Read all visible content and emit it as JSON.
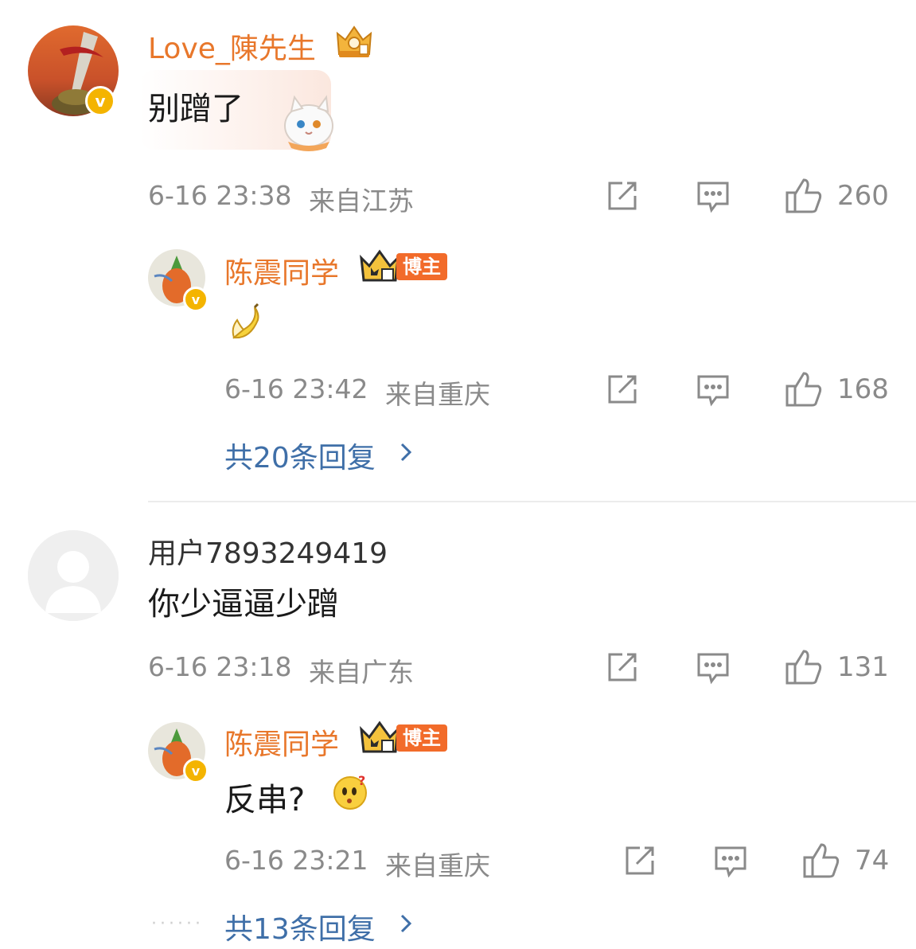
{
  "comments": [
    {
      "username": "Love_陳先生",
      "text": "别蹭了",
      "time": "6-16 23:38",
      "location": "来自江苏",
      "likes": "260",
      "reply": {
        "username": "陈震同学",
        "badge": "博主",
        "text": "",
        "time": "6-16 23:42",
        "location": "来自重庆",
        "likes": "168"
      },
      "more_replies": "共20条回复"
    },
    {
      "username": "用户7893249419",
      "text": "你少逼逼少蹭",
      "time": "6-16 23:18",
      "location": "来自广东",
      "likes": "131",
      "reply": {
        "username": "陈震同学",
        "badge": "博主",
        "text": "反串?",
        "time": "6-16 23:21",
        "location": "来自重庆",
        "likes": "74"
      },
      "more_replies": "共13条回复"
    }
  ],
  "icons": {
    "share": "share-icon",
    "comment": "comment-icon",
    "like": "thumbs-up-icon",
    "chevron": "chevron-right-icon"
  },
  "colors": {
    "username_orange": "#e8772b",
    "link_blue": "#3f6fa8",
    "meta_gray": "#8a8a8a",
    "blogger_tag": "#f26b2a"
  }
}
